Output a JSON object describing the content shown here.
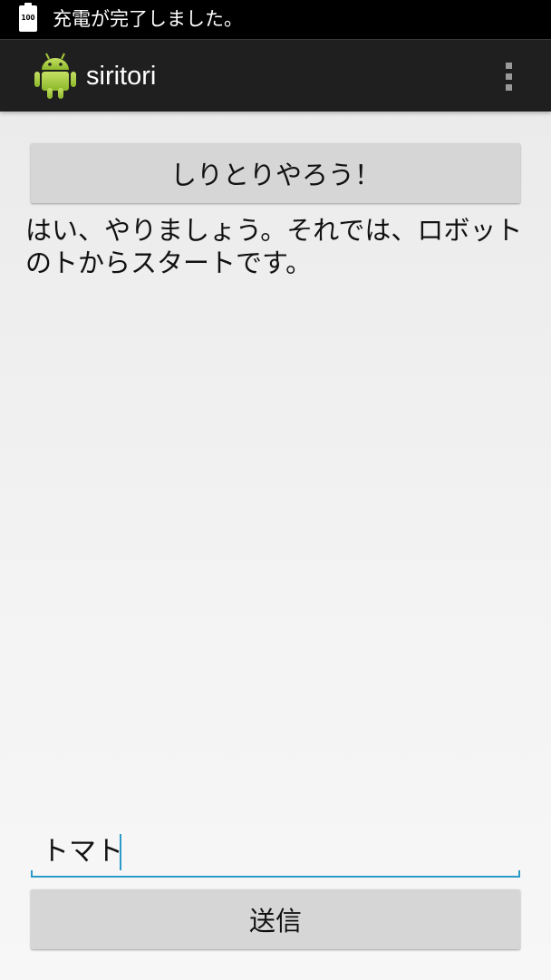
{
  "status_bar": {
    "battery_level": "100",
    "notification_text": "充電が完了しました。"
  },
  "action_bar": {
    "app_icon": "android-robot-icon",
    "title": "siritori",
    "overflow_icon": "overflow-menu-icon"
  },
  "main": {
    "start_button_label": "しりとりやろう！",
    "reply_text": "はい、やりましょう。それでは、ロボットのトからスタートです。",
    "input_value": "トマト",
    "send_button_label": "送信"
  },
  "colors": {
    "accent": "#2a9bc8",
    "android_green": "#a4c639",
    "button_bg": "#d6d6d6",
    "action_bar_bg": "#1f1f1f"
  }
}
